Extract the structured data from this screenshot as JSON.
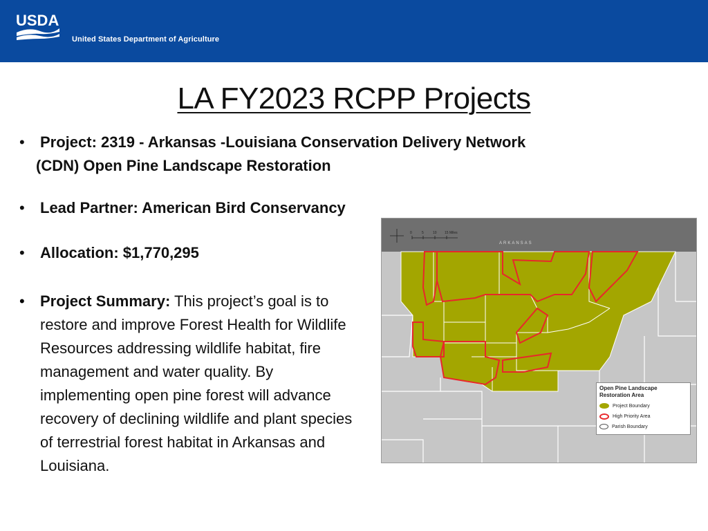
{
  "header": {
    "logo_text": "USDA",
    "agency_name": "United States Department of Agriculture"
  },
  "title": "LA FY2023 RCPP Projects",
  "bullets": {
    "project_line1": "Project: 2319 - Arkansas -Louisiana Conservation Delivery Network",
    "project_line2": "(CDN) Open Pine Landscape Restoration",
    "lead_partner": "Lead Partner: American Bird Conservancy",
    "allocation": "Allocation: $1,770,295",
    "summary_label": "Project Summary:",
    "summary_text": " This project’s goal is to restore and improve Forest Health for Wildlife Resources addressing wildlife habitat, fire management and water quality. By implementing open pine forest will advance recovery of declining wildlife and plant species of terrestrial forest habitat in Arkansas and Louisiana."
  },
  "map": {
    "state_label": "ARKANSAS",
    "scale_labels": [
      "0",
      "5",
      "10",
      "15 Miles"
    ],
    "legend": {
      "title": "Open Pine Landscape Restoration Area",
      "items": [
        {
          "label": "Project Boundary",
          "color": "#a6a800"
        },
        {
          "label": "High Priority Area",
          "color": "#e8272b"
        },
        {
          "label": "Parish Boundary",
          "color": "#ffffff"
        }
      ]
    },
    "colors": {
      "project_fill": "#a3a600",
      "priority_line": "#e8272b",
      "parish_fill": "#c8c8c8",
      "state_fill": "#6f6f6f"
    }
  },
  "colors": {
    "header_blue": "#0a4a9f"
  }
}
